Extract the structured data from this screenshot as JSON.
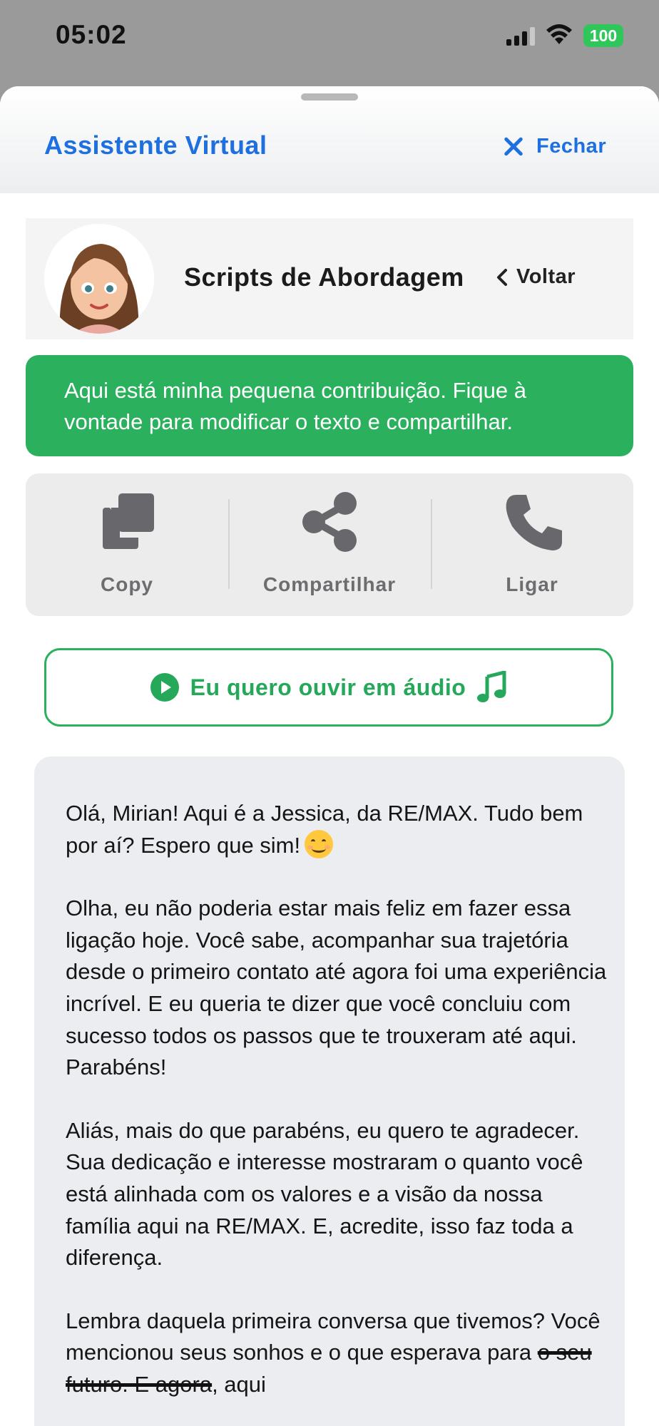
{
  "status_bar": {
    "time": "05:02",
    "battery": "100"
  },
  "header": {
    "title": "Assistente Virtual",
    "close_label": "Fechar"
  },
  "profile": {
    "title": "Scripts de Abordagem",
    "back_label": "Voltar"
  },
  "notice": {
    "text": "Aqui está minha pequena contribuição. Fique à vontade para modificar o texto e compartilhar."
  },
  "actions": [
    {
      "label": "Copy",
      "icon": "copy-icon"
    },
    {
      "label": "Compartilhar",
      "icon": "share-icon"
    },
    {
      "label": "Ligar",
      "icon": "phone-icon"
    }
  ],
  "audio_button": {
    "label": "Eu quero ouvir em áudio",
    "icon_left": "play-circle-icon",
    "icon_right": "music-note-icon"
  },
  "message": {
    "p1": "Olá, Mirian! Aqui é a Jessica, da RE/MAX. Tudo bem por aí? Espero que sim!",
    "p2": "Olha, eu não poderia estar mais feliz em fazer essa ligação hoje. Você sabe, acompanhar sua trajetória desde o primeiro contato até agora foi uma experiência incrível. E eu queria te dizer que você concluiu com sucesso todos os passos que te trouxeram até aqui. Parabéns!",
    "p3": "Aliás, mais do que parabéns, eu quero te agradecer. Sua dedicação e interesse mostraram o quanto você está alinhada com os valores e a visão da nossa família aqui na RE/MAX. E, acredite, isso faz toda a diferença.",
    "p4_start": "Lembra daquela primeira conversa que tivemos? Você mencionou seus sonhos e o que esperava para ",
    "p4_strike": "o seu futuro. E agora",
    "p4_end": ", aqui"
  },
  "colors": {
    "accent_blue": "#1e6fe0",
    "accent_green": "#2bb05e",
    "battery_green": "#2fc65a"
  }
}
